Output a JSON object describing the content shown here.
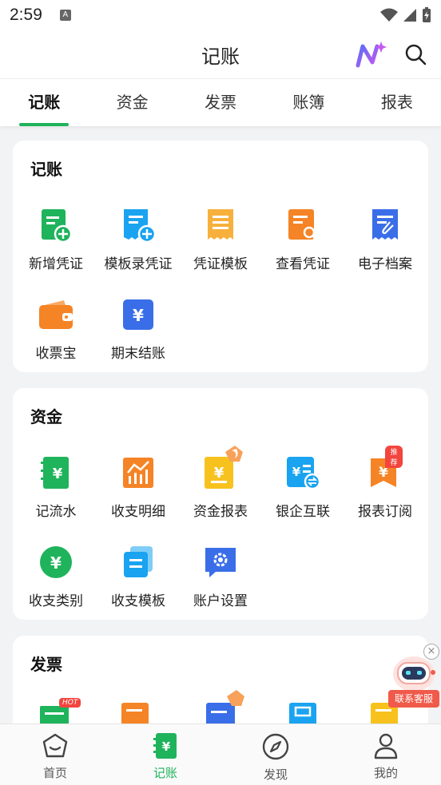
{
  "status_bar": {
    "time": "2:59",
    "notif_letter": "A"
  },
  "header": {
    "title": "记账"
  },
  "tabs": [
    {
      "label": "记账",
      "active": true
    },
    {
      "label": "资金"
    },
    {
      "label": "发票"
    },
    {
      "label": "账簿"
    },
    {
      "label": "报表"
    }
  ],
  "sections": {
    "jizhang": {
      "title": "记账",
      "items": [
        {
          "label": "新增凭证",
          "icon": "new-voucher-icon",
          "color": "#1fb35b"
        },
        {
          "label": "模板录凭证",
          "icon": "template-voucher-icon",
          "color": "#1aa3f0"
        },
        {
          "label": "凭证模板",
          "icon": "voucher-template-icon",
          "color": "#f7b03c"
        },
        {
          "label": "查看凭证",
          "icon": "view-voucher-icon",
          "color": "#f58426"
        },
        {
          "label": "电子档案",
          "icon": "e-archive-icon",
          "color": "#3a6ee8"
        },
        {
          "label": "收票宝",
          "icon": "wallet-icon",
          "color": "#f58426"
        },
        {
          "label": "期末结账",
          "icon": "closing-icon",
          "color": "#3a6ee8"
        }
      ]
    },
    "zijin": {
      "title": "资金",
      "items": [
        {
          "label": "记流水",
          "icon": "cashflow-icon",
          "color": "#1fb35b"
        },
        {
          "label": "收支明细",
          "icon": "income-detail-icon",
          "color": "#f58426"
        },
        {
          "label": "资金报表",
          "icon": "fund-report-icon",
          "color": "#f7c21e"
        },
        {
          "label": "银企互联",
          "icon": "bank-link-icon",
          "color": "#1aa3f0"
        },
        {
          "label": "报表订阅",
          "icon": "report-subscribe-icon",
          "color": "#f58426",
          "badge": "推荐"
        },
        {
          "label": "收支类别",
          "icon": "category-icon",
          "color": "#1fb35b"
        },
        {
          "label": "收支模板",
          "icon": "income-template-icon",
          "color": "#1aa3f0"
        },
        {
          "label": "账户设置",
          "icon": "account-settings-icon",
          "color": "#3a6ee8"
        }
      ]
    },
    "fapiao": {
      "title": "发票",
      "first_badge": "HOT"
    }
  },
  "bottom_nav": [
    {
      "label": "首页",
      "icon": "home-icon"
    },
    {
      "label": "记账",
      "icon": "ledger-icon",
      "active": true
    },
    {
      "label": "发现",
      "icon": "compass-icon"
    },
    {
      "label": "我的",
      "icon": "profile-icon"
    }
  ],
  "customer_service": {
    "label": "联系客服",
    "close": "×"
  },
  "colors": {
    "accent": "#1fb35b",
    "orange": "#f58426",
    "blue": "#3a6ee8",
    "sky": "#1aa3f0",
    "yellow": "#f7b03c"
  }
}
